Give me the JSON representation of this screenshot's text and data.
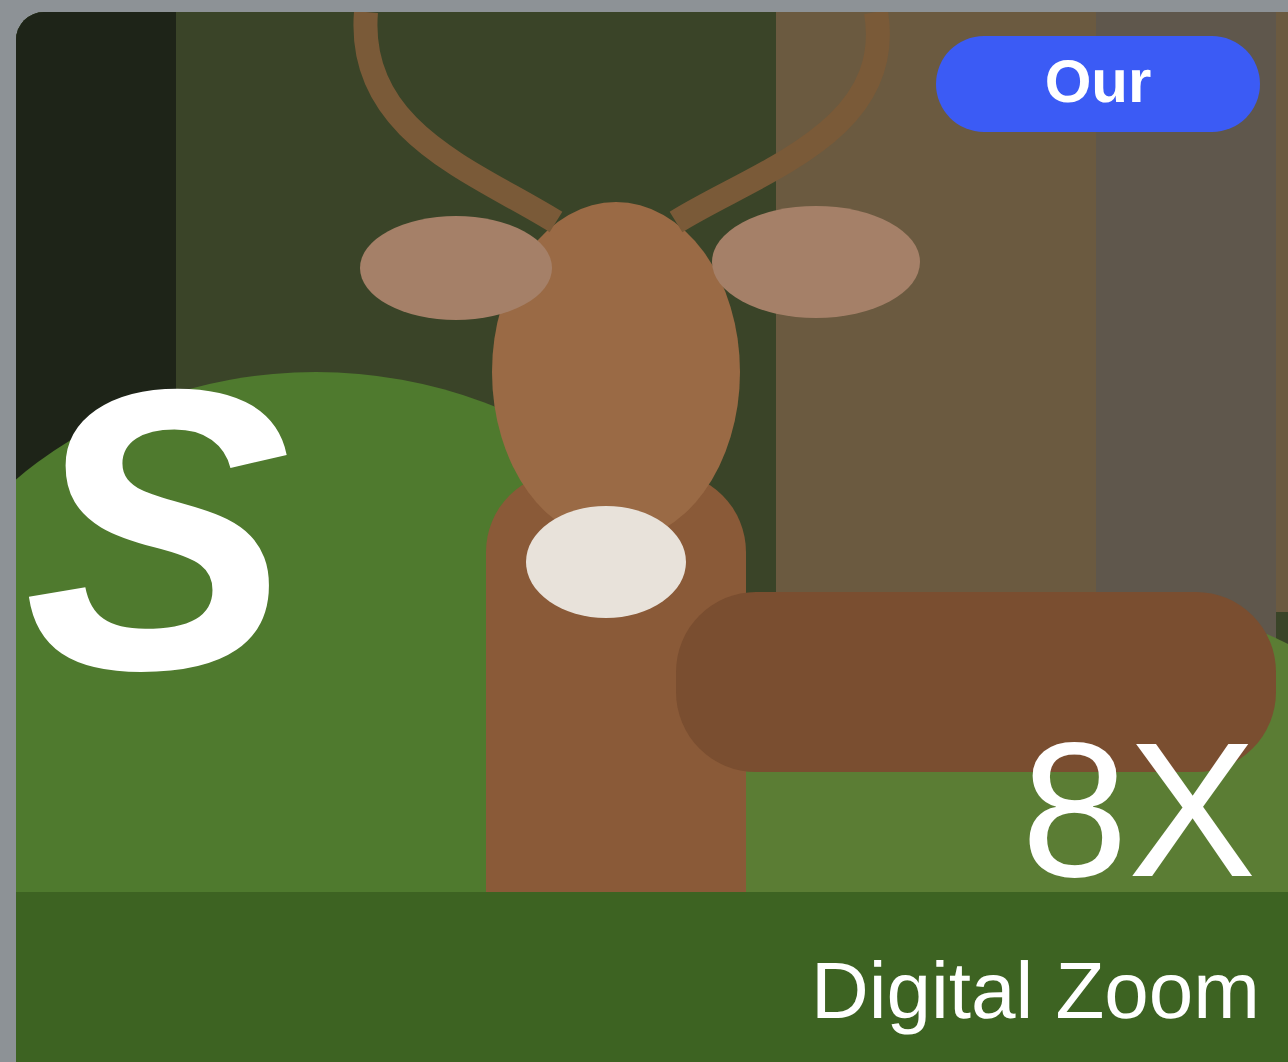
{
  "card": {
    "badge": {
      "label": "Our"
    },
    "comparison_mark": "S",
    "headline": "8X",
    "subheadline": "Digital Zoom"
  }
}
